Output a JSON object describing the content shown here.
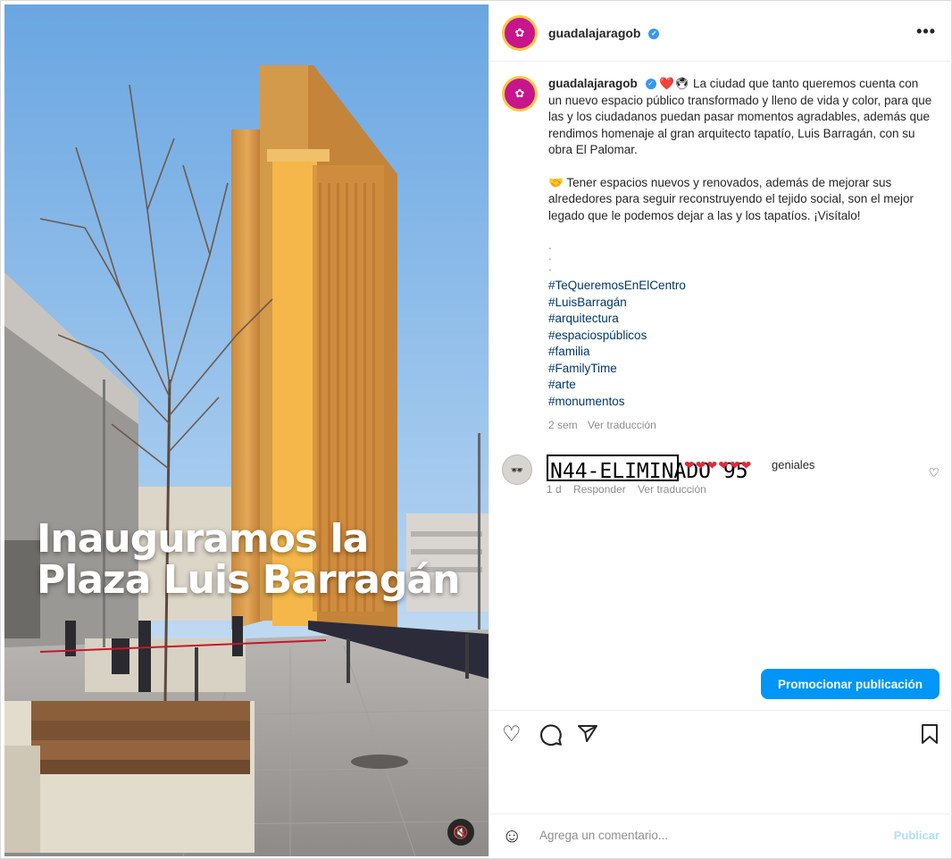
{
  "post": {
    "username": "guadalajaragob",
    "verified_icon": "verified-badge-icon",
    "more_label": "•••",
    "overlay_title_line1": "Inauguramos la",
    "overlay_title_line2": "Plaza Luis Barragán",
    "mute_icon": "volume-off-icon"
  },
  "caption": {
    "username": "guadalajaragob",
    "emoji_prefix": "❤️🖲",
    "para1": "La ciudad que tanto queremos cuenta con un nuevo espacio público transformado y lleno de vida y color, para que las y los ciudadanos puedan pasar momentos agradables, además que rendimos homenaje al gran arquitecto tapatío, Luis Barragán, con su obra El Palomar.",
    "para2_emoji": "🤝",
    "para2": "Tener espacios nuevos y renovados, además de mejorar sus alrededores para seguir reconstruyendo el tejido social, son el mejor legado que le podemos dejar a las y los tapatíos. ¡Visítalo!",
    "dots": [
      ".",
      ".",
      "."
    ],
    "hashtags": [
      "#TeQueremosEnElCentro",
      "#LuisBarragán",
      "#arquitectura",
      "#espaciospúblicos",
      "#familia",
      "#FamilyTime",
      "#arte",
      "#monumentos"
    ],
    "time": "2 sem",
    "translate": "Ver traducción"
  },
  "comment": {
    "redacted_label": "N44-ELIMINADO 95",
    "hearts": "❤❤❤❤❤❤",
    "text": "geniales",
    "time": "1 d",
    "reply": "Responder",
    "translate": "Ver traducción",
    "like_icon": "heart-outline-icon"
  },
  "promote_button": "Promocionar publicación",
  "actions": {
    "like_icon": "heart-icon",
    "comment_icon": "comment-icon",
    "share_icon": "send-icon",
    "save_icon": "bookmark-icon"
  },
  "add_comment": {
    "placeholder": "Agrega un comentario...",
    "publish": "Publicar",
    "emoji_icon": "smiley-icon"
  },
  "colors": {
    "accent": "#0095f6",
    "avatar_bg": "#c7158b",
    "hashtag": "#00376b"
  }
}
